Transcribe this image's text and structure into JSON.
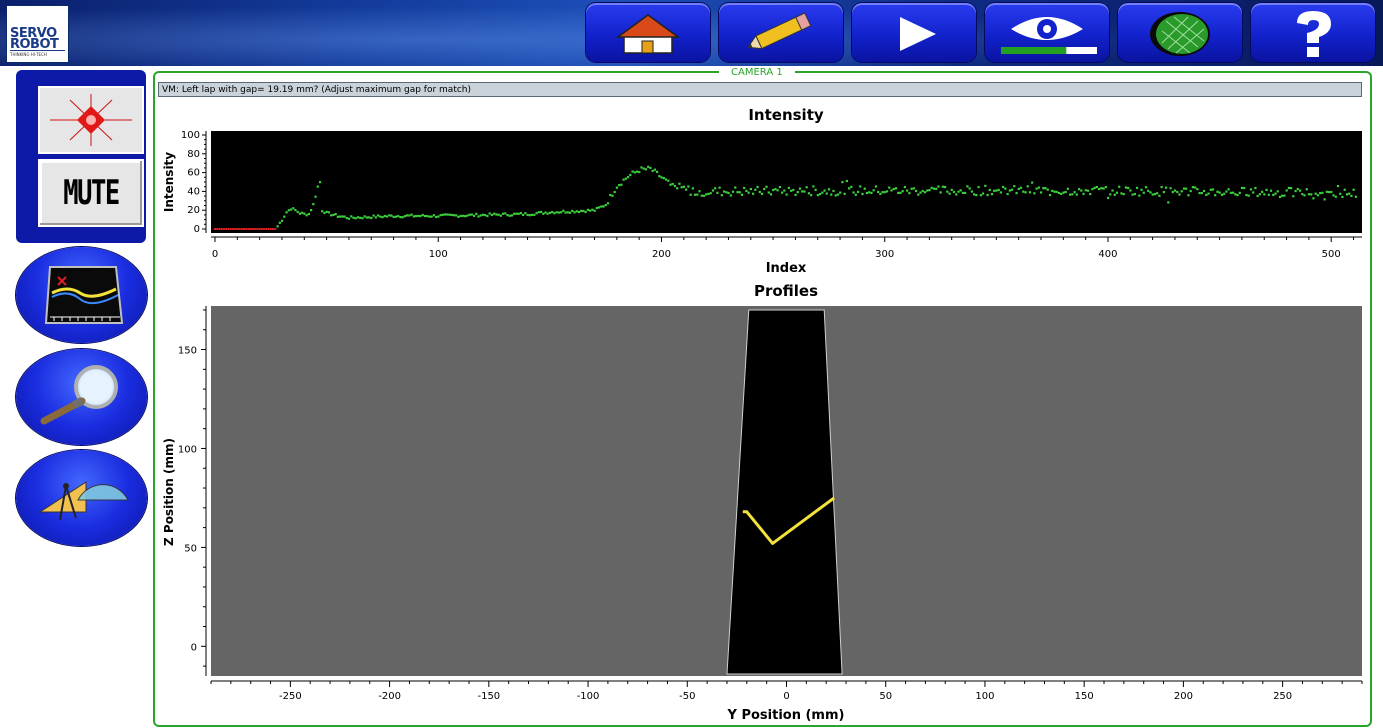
{
  "logo": {
    "line1": "SERVO",
    "line2": "ROBOT",
    "tagline": "THINKING HI-TECH"
  },
  "toolbar": [
    {
      "name": "home-icon"
    },
    {
      "name": "pencil-icon"
    },
    {
      "name": "play-icon"
    },
    {
      "name": "eye-icon",
      "progress": 0.68
    },
    {
      "name": "globe-net-icon"
    },
    {
      "name": "help-icon"
    }
  ],
  "left_panel": {
    "laser_button": {
      "icon": "laser-icon"
    },
    "mute_button": {
      "label": "MUTE"
    },
    "oval_buttons": [
      {
        "icon": "profile-graph-icon"
      },
      {
        "icon": "magnifier-icon"
      },
      {
        "icon": "geometry-tools-icon"
      }
    ]
  },
  "camera": {
    "label": "CAMERA 1"
  },
  "status": {
    "message": "VM: Left lap with gap= 19.19 mm? (Adjust maximum gap for match)"
  },
  "colors": {
    "accent_green": "#2aa52a",
    "intensity_points": "#3cd23c",
    "profile_line": "#f2e23a",
    "masked_points": "#e02020"
  },
  "chart_data": [
    {
      "type": "scatter",
      "title": "Intensity",
      "xlabel": "Index",
      "ylabel": "Intensity",
      "xlim": [
        0,
        512
      ],
      "ylim": [
        0,
        100
      ],
      "x_ticks": [
        0,
        100,
        200,
        300,
        400,
        500
      ],
      "y_ticks": [
        0,
        20,
        40,
        60,
        80,
        100
      ],
      "x_tick_labels": [
        "0",
        "100",
        "200",
        "300",
        "400",
        "500"
      ],
      "y_tick_labels": [
        "0",
        "20",
        "40",
        "60",
        "80",
        "100"
      ],
      "masked_range": [
        0,
        28
      ],
      "masked_value": 0,
      "profile": [
        [
          28,
          3
        ],
        [
          30,
          10
        ],
        [
          32,
          18
        ],
        [
          34,
          22
        ],
        [
          36,
          20
        ],
        [
          38,
          17
        ],
        [
          40,
          16
        ],
        [
          42,
          16
        ],
        [
          44,
          26
        ],
        [
          46,
          45
        ],
        [
          47,
          50
        ],
        [
          48,
          20
        ],
        [
          50,
          17
        ],
        [
          55,
          14
        ],
        [
          60,
          12
        ],
        [
          70,
          13
        ],
        [
          80,
          14
        ],
        [
          100,
          14
        ],
        [
          120,
          15
        ],
        [
          140,
          16
        ],
        [
          150,
          18
        ],
        [
          160,
          19
        ],
        [
          170,
          20
        ],
        [
          175,
          26
        ],
        [
          180,
          46
        ],
        [
          185,
          56
        ],
        [
          190,
          63
        ],
        [
          195,
          64
        ],
        [
          200,
          55
        ],
        [
          205,
          45
        ],
        [
          215,
          40
        ],
        [
          300,
          41
        ],
        [
          400,
          41
        ],
        [
          512,
          38
        ]
      ],
      "noise": 5,
      "grid": false
    },
    {
      "type": "line",
      "title": "Profiles",
      "xlabel": "Y Position (mm)",
      "ylabel": "Z Position (mm)",
      "xlim": [
        -290,
        290
      ],
      "ylim": [
        -15,
        172
      ],
      "x_ticks": [
        -250,
        -200,
        -150,
        -100,
        -50,
        0,
        50,
        100,
        150,
        200,
        250
      ],
      "y_ticks": [
        0,
        50,
        100,
        150
      ],
      "x_tick_labels": [
        "-250",
        "-200",
        "-150",
        "-100",
        "-50",
        "0",
        "50",
        "100",
        "150",
        "200",
        "250"
      ],
      "y_tick_labels": [
        "0",
        "50",
        "100",
        "150"
      ],
      "field_of_view": [
        [
          -19,
          170
        ],
        [
          19,
          170
        ],
        [
          28,
          -14
        ],
        [
          -30,
          -14
        ]
      ],
      "series": [
        {
          "points": [
            [
              -22,
              68
            ],
            [
              -20,
              68
            ],
            [
              -7,
              52
            ],
            [
              24,
              75
            ]
          ]
        }
      ],
      "grid": false
    }
  ]
}
